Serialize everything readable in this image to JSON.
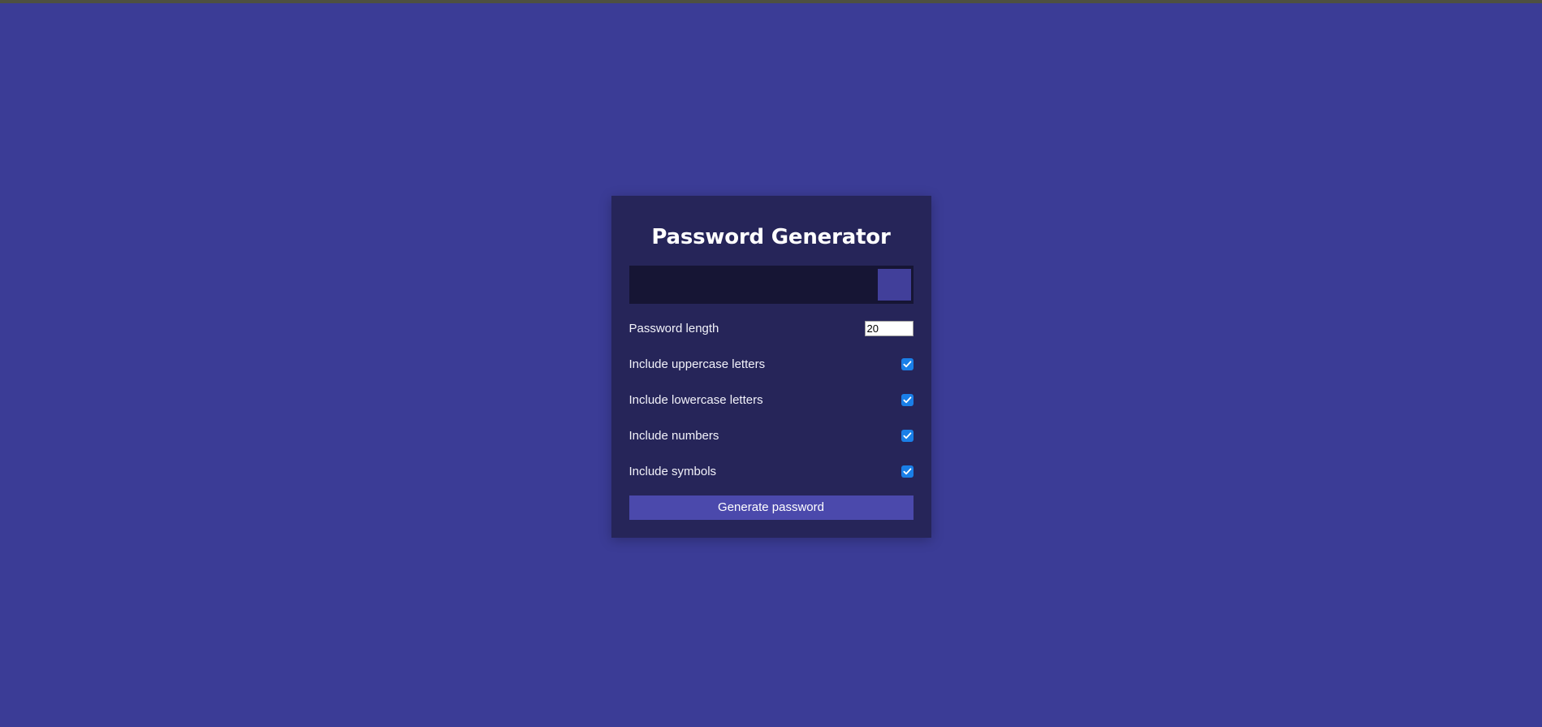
{
  "theme": {
    "page_background": "#3b3c96",
    "card_background": "#262559",
    "output_background": "#161534",
    "accent": "#4b49ac",
    "checkbox_color": "#1a7fe8",
    "text_color": "#f2f2fa"
  },
  "card": {
    "title": "Password Generator",
    "password_output": {
      "value": "",
      "placeholder": ""
    },
    "copy_button": {
      "label": "",
      "icon": "copy-icon"
    },
    "length_row": {
      "label": "Password length",
      "value": "20"
    },
    "checkbox_options": [
      {
        "label": "Include uppercase letters",
        "checked": true
      },
      {
        "label": "Include lowercase letters",
        "checked": true
      },
      {
        "label": "Include numbers",
        "checked": true
      },
      {
        "label": "Include symbols",
        "checked": true
      }
    ],
    "generate_button": {
      "label": "Generate password"
    }
  }
}
